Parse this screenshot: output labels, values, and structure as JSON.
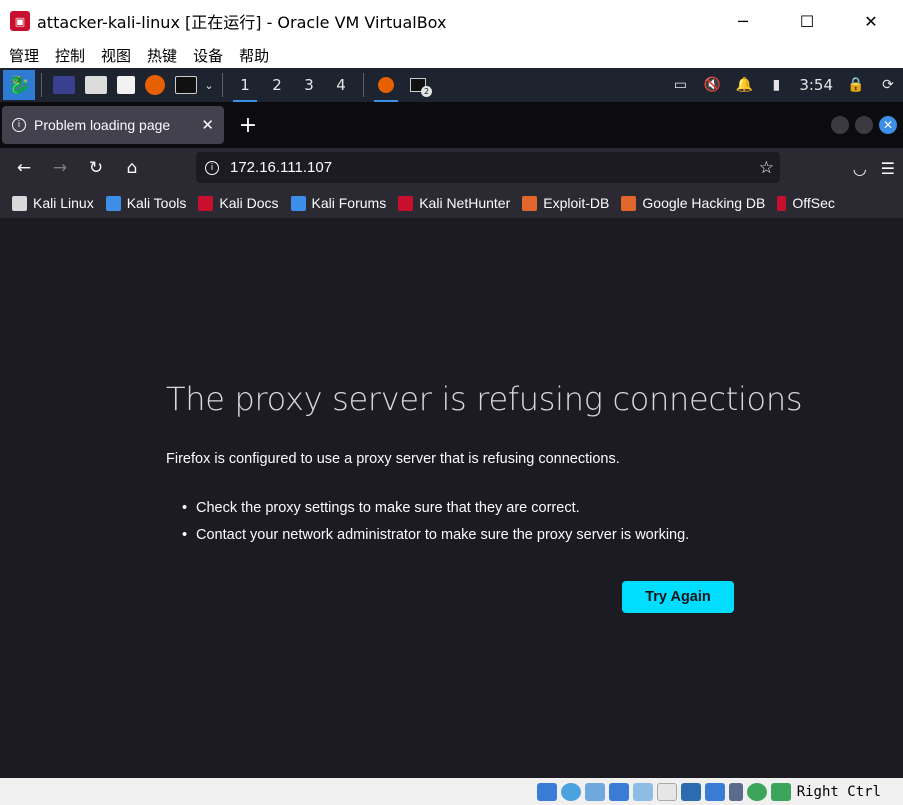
{
  "window": {
    "title": "attacker-kali-linux [正在运行] - Oracle VM VirtualBox",
    "controls": [
      "─",
      "☐",
      "✕"
    ]
  },
  "vbox_menu": [
    "管理",
    "控制",
    "视图",
    "热键",
    "设备",
    "帮助"
  ],
  "kali_panel": {
    "workspaces": [
      "1",
      "2",
      "3",
      "4"
    ],
    "active_workspace": "1",
    "terminal_badge": "2",
    "clock": "3:54"
  },
  "firefox": {
    "tab_title": "Problem loading page",
    "new_tab_label": "+",
    "url": "172.16.111.107",
    "bookmarks": [
      {
        "label": "Kali Linux",
        "color": "#d9d9d9"
      },
      {
        "label": "Kali Tools",
        "color": "#3d8ee8"
      },
      {
        "label": "Kali Docs",
        "color": "#c8102e"
      },
      {
        "label": "Kali Forums",
        "color": "#3d8ee8"
      },
      {
        "label": "Kali NetHunter",
        "color": "#c8102e"
      },
      {
        "label": "Exploit-DB",
        "color": "#e0662c"
      },
      {
        "label": "Google Hacking DB",
        "color": "#e0662c"
      },
      {
        "label": "OffSec",
        "color": "#c8102e"
      }
    ]
  },
  "error_page": {
    "title": "The proxy server is refusing connections",
    "description": "Firefox is configured to use a proxy server that is refusing connections.",
    "suggestions": [
      "Check the proxy settings to make sure that they are correct.",
      "Contact your network administrator to make sure the proxy server is working."
    ],
    "button_label": "Try Again",
    "button_color": "#00ddff"
  },
  "vbox_status": {
    "host_key": "Right Ctrl"
  }
}
